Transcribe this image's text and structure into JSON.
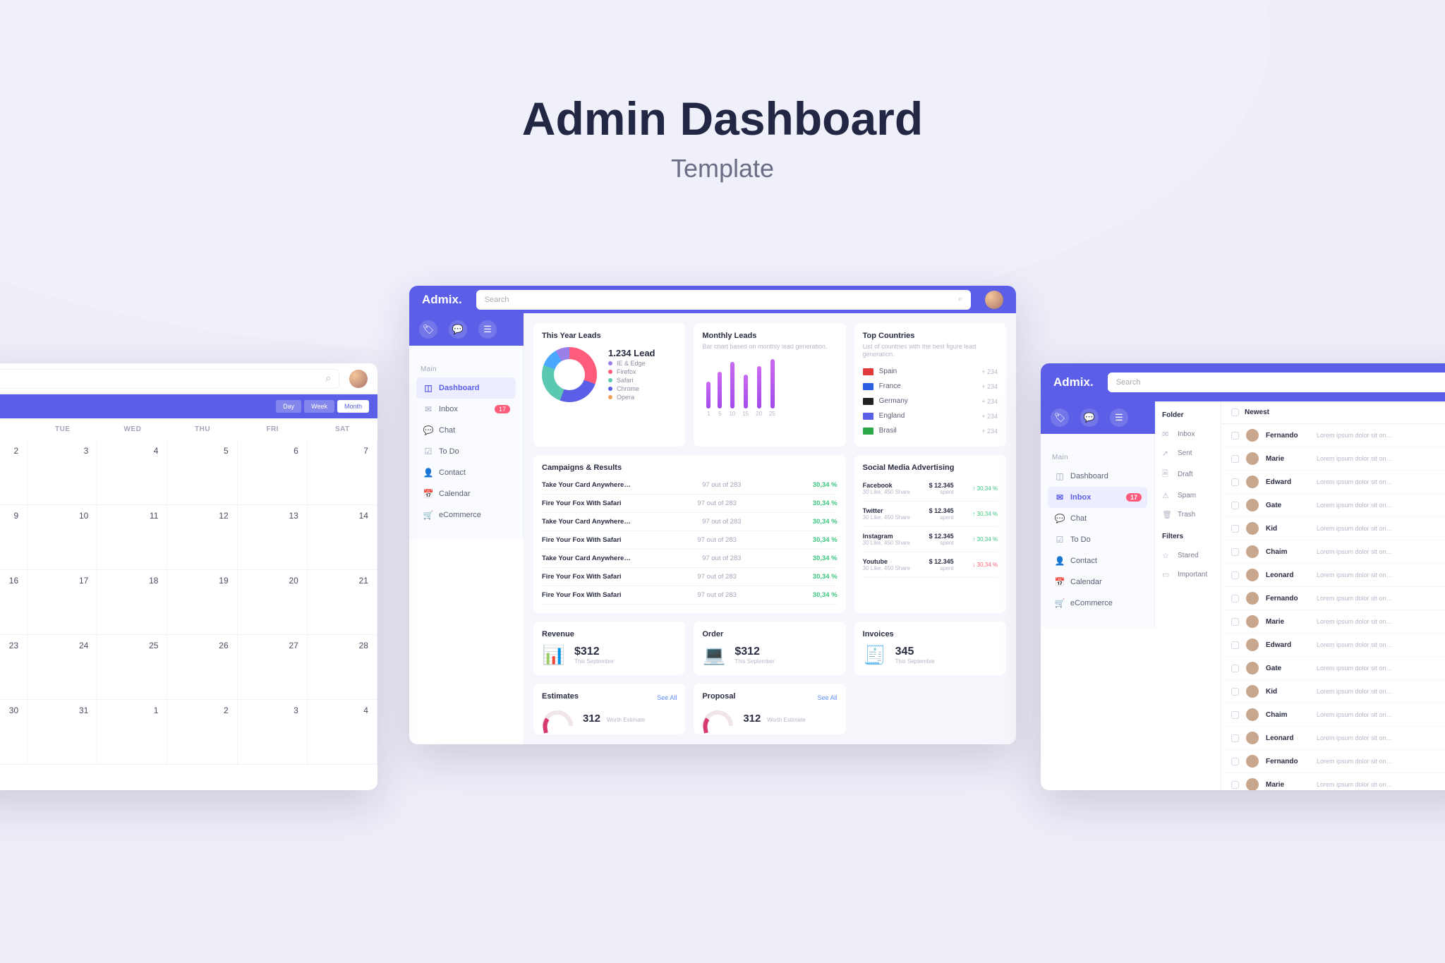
{
  "hero": {
    "title": "Admin Dashboard",
    "subtitle": "Template"
  },
  "brand": "Admix.",
  "search_placeholder": "Search",
  "nav": {
    "section": "Main",
    "items": [
      {
        "label": "Dashboard",
        "icon": "◫"
      },
      {
        "label": "Inbox",
        "icon": "✉",
        "badge": "17"
      },
      {
        "label": "Chat",
        "icon": "💬"
      },
      {
        "label": "To Do",
        "icon": "☑"
      },
      {
        "label": "Contact",
        "icon": "👤"
      },
      {
        "label": "Calendar",
        "icon": "📅"
      },
      {
        "label": "eCommerce",
        "icon": "🛒"
      }
    ]
  },
  "leads": {
    "title": "This Year Leads",
    "value": "1.234 Lead",
    "legend": [
      {
        "label": "IE & Edge",
        "color": "#9b7fe8"
      },
      {
        "label": "Firefox",
        "color": "#ff5b7a"
      },
      {
        "label": "Safari",
        "color": "#5bc8b1"
      },
      {
        "label": "Chrome",
        "color": "#5b5ee6"
      },
      {
        "label": "Opera",
        "color": "#f0a05b"
      }
    ]
  },
  "monthly": {
    "title": "Monthly Leads",
    "subtitle": "Bar chart based on monthly lead generation.",
    "bars": [
      {
        "label": "1",
        "h": 38
      },
      {
        "label": "5",
        "h": 52
      },
      {
        "label": "10",
        "h": 66
      },
      {
        "label": "15",
        "h": 48
      },
      {
        "label": "20",
        "h": 60
      },
      {
        "label": "25",
        "h": 70
      }
    ]
  },
  "countries": {
    "title": "Top Countries",
    "subtitle": "List of countries with the best figure lead generation.",
    "rows": [
      {
        "name": "Spain",
        "val": "+ 234",
        "color": "#e03a3a"
      },
      {
        "name": "France",
        "val": "+ 234",
        "color": "#2c5fe0"
      },
      {
        "name": "Germany",
        "val": "+ 234",
        "color": "#222"
      },
      {
        "name": "England",
        "val": "+ 234",
        "color": "#5b5ee6"
      },
      {
        "name": "Brasil",
        "val": "+ 234",
        "color": "#2aa84a"
      }
    ]
  },
  "campaigns": {
    "title": "Campaigns & Results",
    "rows": [
      {
        "name": "Take Your Card Anywhere…",
        "out": "97 out of 283",
        "pct": "30,34 %"
      },
      {
        "name": "Fire Your Fox With Safari",
        "out": "97 out of 283",
        "pct": "30,34 %"
      },
      {
        "name": "Take Your Card Anywhere…",
        "out": "97 out of 283",
        "pct": "30,34 %"
      },
      {
        "name": "Fire Your Fox With Safari",
        "out": "97 out of 283",
        "pct": "30,34 %"
      },
      {
        "name": "Take Your Card Anywhere…",
        "out": "97 out of 283",
        "pct": "30,34 %"
      },
      {
        "name": "Fire Your Fox With Safari",
        "out": "97 out of 283",
        "pct": "30,34 %"
      },
      {
        "name": "Fire Your Fox With Safari",
        "out": "97 out of 283",
        "pct": "30,34 %"
      }
    ]
  },
  "social": {
    "title": "Social Media Advertising",
    "rows": [
      {
        "name": "Facebook",
        "meta": "30 Like, 450 Share",
        "amt": "$ 12.345",
        "delta": "30,34 %",
        "dir": "up",
        "spent": "spent"
      },
      {
        "name": "Twitter",
        "meta": "30 Like, 450 Share",
        "amt": "$ 12.345",
        "delta": "30,34 %",
        "dir": "up",
        "spent": "spent"
      },
      {
        "name": "Instagram",
        "meta": "30 Like, 450 Share",
        "amt": "$ 12.345",
        "delta": "30,34 %",
        "dir": "up",
        "spent": "spent"
      },
      {
        "name": "Youtube",
        "meta": "30 Like, 450 Share",
        "amt": "$ 12.345",
        "delta": "30,34 %",
        "dir": "down",
        "spent": "spent"
      }
    ]
  },
  "kpis": {
    "revenue": {
      "title": "Revenue",
      "value": "$312",
      "sub": "This September"
    },
    "order": {
      "title": "Order",
      "value": "$312",
      "sub": "This September"
    },
    "invoices": {
      "title": "Invoices",
      "value": "345",
      "sub": "This September"
    }
  },
  "estimates": {
    "title": "Estimates",
    "see": "See All",
    "value": "312",
    "label": "Worth Estimate"
  },
  "proposal": {
    "title": "Proposal",
    "see": "See All",
    "value": "312",
    "label": "Worth Estimate"
  },
  "calendar": {
    "views": [
      "Day",
      "Week",
      "Month"
    ],
    "days": [
      "TUE",
      "WED",
      "THU",
      "FRI",
      "SAT"
    ],
    "cells": [
      [
        "2",
        "3",
        "4",
        "5",
        "6",
        "7"
      ],
      [
        "9",
        "10",
        "11",
        "12",
        "13",
        "14"
      ],
      [
        "16",
        "17",
        "18",
        "19",
        "20",
        "21"
      ],
      [
        "23",
        "24",
        "25",
        "26",
        "27",
        "28"
      ],
      [
        "30",
        "31",
        "1",
        "2",
        "3",
        "4"
      ]
    ]
  },
  "inbox": {
    "folder_title": "Folder",
    "folders": [
      {
        "label": "Inbox",
        "icon": "✉"
      },
      {
        "label": "Sent",
        "icon": "➚"
      },
      {
        "label": "Draft",
        "icon": "🗎"
      },
      {
        "label": "Spam",
        "icon": "⚠"
      },
      {
        "label": "Trash",
        "icon": "🗑"
      }
    ],
    "filters_title": "Filters",
    "filters": [
      {
        "label": "Stared",
        "icon": "☆"
      },
      {
        "label": "Important",
        "icon": "▭"
      }
    ],
    "newest": "Newest",
    "preview": "Lorem ipsum dolor sit on…",
    "mails": [
      "Fernando",
      "Marie",
      "Edward",
      "Gate",
      "Kid",
      "Chaim",
      "Leonard",
      "Fernando",
      "Marie",
      "Edward",
      "Gate",
      "Kid",
      "Chaim",
      "Leonard",
      "Fernando",
      "Marie"
    ]
  },
  "chart_data": [
    {
      "type": "pie",
      "title": "This Year Leads",
      "series": [
        {
          "name": "IE & Edge",
          "values": [
            8
          ]
        },
        {
          "name": "Firefox",
          "values": [
            30
          ]
        },
        {
          "name": "Safari",
          "values": [
            25
          ]
        },
        {
          "name": "Chrome",
          "values": [
            25
          ]
        },
        {
          "name": "Opera",
          "values": [
            12
          ]
        }
      ],
      "annotations": [
        "1.234 Lead"
      ]
    },
    {
      "type": "bar",
      "title": "Monthly Leads",
      "categories": [
        "1",
        "5",
        "10",
        "15",
        "20",
        "25"
      ],
      "values": [
        38,
        52,
        66,
        48,
        60,
        70
      ],
      "ylim": [
        0,
        80
      ]
    }
  ]
}
